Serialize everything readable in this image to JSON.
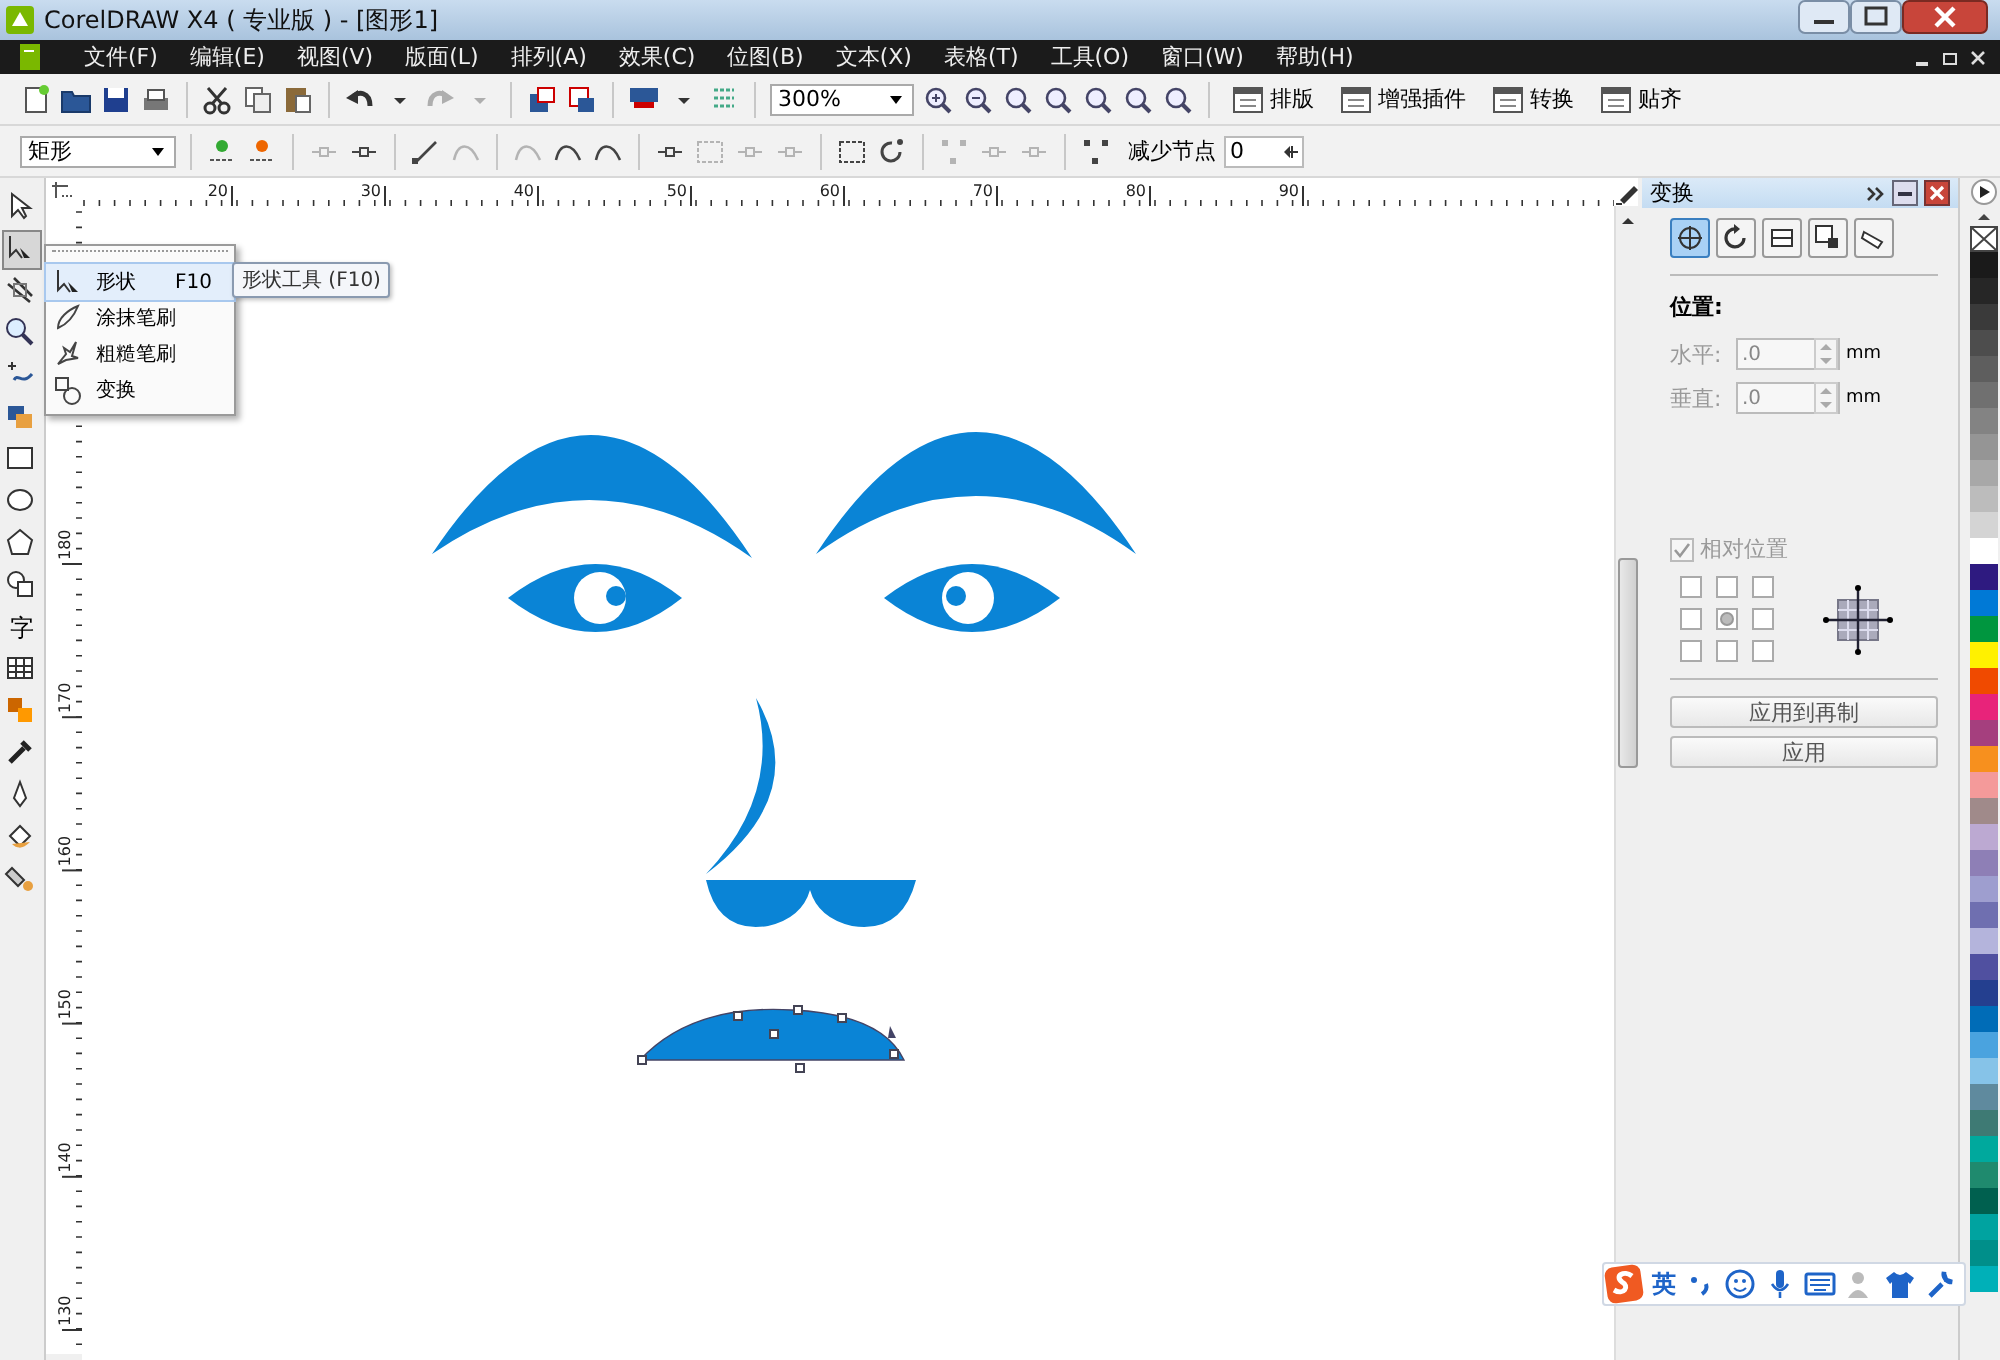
{
  "window": {
    "title": "CorelDRAW X4 ( 专业版 ) - [图形1]"
  },
  "menu_bar": {
    "items": [
      "文件(F)",
      "编辑(E)",
      "视图(V)",
      "版面(L)",
      "排列(A)",
      "效果(C)",
      "位图(B)",
      "文本(X)",
      "表格(T)",
      "工具(O)",
      "窗口(W)",
      "帮助(H)"
    ]
  },
  "standard_toolbar": {
    "buttons": [
      {
        "disabled": false
      },
      {
        "disabled": false
      },
      {
        "disabled": false
      },
      {
        "disabled": false
      },
      {
        "disabled": false
      },
      {
        "disabled": false
      },
      {
        "disabled": false
      },
      {
        "disabled": false
      },
      {
        "disabled": false
      },
      {
        "disabled": true
      },
      {
        "disabled": true
      },
      {
        "disabled": false
      },
      {
        "disabled": false
      },
      {
        "disabled": false
      },
      {
        "disabled": false
      },
      {
        "disabled": false
      }
    ],
    "zoom_level": "300%",
    "zoom_buttons": [
      {
        "disabled": false
      },
      {
        "disabled": false
      },
      {
        "disabled": false
      },
      {
        "disabled": false
      },
      {
        "disabled": false
      },
      {
        "disabled": false
      },
      {
        "disabled": false
      }
    ],
    "plugin_buttons": [
      "排版",
      "增强插件",
      "转换",
      "贴齐"
    ]
  },
  "property_bar": {
    "object_type": "矩形",
    "buttons": [
      {
        "disabled": false
      },
      {
        "disabled": false
      },
      {
        "disabled": true
      },
      {
        "disabled": false
      },
      {
        "disabled": false
      },
      {
        "disabled": true
      },
      {
        "disabled": true
      },
      {
        "disabled": false
      },
      {
        "disabled": false
      },
      {
        "disabled": false
      },
      {
        "disabled": true
      },
      {
        "disabled": true
      },
      {
        "disabled": true
      },
      {
        "disabled": false
      },
      {
        "disabled": false
      },
      {
        "disabled": true
      },
      {
        "disabled": true
      },
      {
        "disabled": true
      },
      {
        "disabled": false
      }
    ],
    "reduce_nodes": {
      "label": "减少节点",
      "value": "0"
    }
  },
  "toolbox": {
    "tools": [
      {
        "selected": false
      },
      {
        "selected": true
      },
      {
        "selected": false
      },
      {
        "selected": false
      },
      {
        "selected": false
      },
      {
        "selected": false
      },
      {
        "selected": false
      },
      {
        "selected": false
      },
      {
        "selected": false
      },
      {
        "selected": false
      },
      {
        "selected": false,
        "glyph": "字"
      },
      {
        "selected": false
      },
      {
        "selected": false
      },
      {
        "selected": false
      },
      {
        "selected": false
      },
      {
        "selected": false
      },
      {
        "selected": false
      }
    ]
  },
  "flyout_menu": {
    "items": [
      {
        "label": "形状",
        "shortcut": "F10",
        "selected": true
      },
      {
        "label": "涂抹笔刷",
        "selected": false
      },
      {
        "label": "粗糙笔刷",
        "selected": false
      },
      {
        "label": "变换",
        "selected": false
      }
    ]
  },
  "tooltip": "形状工具 (F10)",
  "rulers": {
    "horizontal": [
      "20",
      "30",
      "40",
      "50",
      "60",
      "70",
      "80",
      "90"
    ],
    "vertical": [
      "180",
      "170",
      "160",
      "150",
      "140",
      "130"
    ]
  },
  "docker": {
    "title": "变换",
    "tabs": [
      {
        "selected": true
      },
      {
        "selected": false
      },
      {
        "selected": false
      },
      {
        "selected": false
      },
      {
        "selected": false
      }
    ],
    "section_label": "位置:",
    "fields": [
      {
        "label": "水平:",
        "value": ".0",
        "unit": "mm",
        "disabled": true
      },
      {
        "label": "垂直:",
        "value": ".0",
        "unit": "mm",
        "disabled": true
      }
    ],
    "relative_position": {
      "label": "相对位置",
      "checked": true,
      "disabled": true
    },
    "anchors": [
      {
        "selected": false
      },
      {
        "selected": false
      },
      {
        "selected": false
      },
      {
        "selected": false
      },
      {
        "selected": true
      },
      {
        "selected": false
      },
      {
        "selected": false
      },
      {
        "selected": false
      },
      {
        "selected": false
      }
    ],
    "buttons": [
      "应用到再制",
      "应用"
    ]
  },
  "palette": {
    "colors": [
      {
        "color": "#1a1a1a"
      },
      {
        "color": "#262626"
      },
      {
        "color": "#3a3a3a"
      },
      {
        "color": "#4d4d4d"
      },
      {
        "color": "#5e5e5e"
      },
      {
        "color": "#707070"
      },
      {
        "color": "#838383"
      },
      {
        "color": "#959595"
      },
      {
        "color": "#a8a8a8"
      },
      {
        "color": "#bcbcbc"
      },
      {
        "color": "#d4d4d4"
      },
      {
        "color": "#ffffff"
      },
      {
        "color": "#2e1a80"
      },
      {
        "color": "#0079d6"
      },
      {
        "color": "#00963f"
      },
      {
        "color": "#fff100"
      },
      {
        "color": "#f04a00"
      },
      {
        "color": "#e8237a"
      },
      {
        "color": "#a53f7e"
      },
      {
        "color": "#f7901e"
      },
      {
        "color": "#f49a9a"
      },
      {
        "color": "#a08a8a"
      },
      {
        "color": "#bca9d2"
      },
      {
        "color": "#8e7fb6"
      },
      {
        "color": "#9e9ecf"
      },
      {
        "color": "#6f6fb0"
      },
      {
        "color": "#b4b4dc"
      },
      {
        "color": "#5050a0"
      },
      {
        "color": "#243f8f"
      },
      {
        "color": "#006cb7"
      },
      {
        "color": "#4aa3df"
      },
      {
        "color": "#86c3e8"
      },
      {
        "color": "#5f8a9e"
      },
      {
        "color": "#3e7a74"
      },
      {
        "color": "#00a99d"
      },
      {
        "color": "#1f8a6e"
      },
      {
        "color": "#00604f"
      },
      {
        "color": "#00a3a0"
      },
      {
        "color": "#008f8a"
      },
      {
        "color": "#00b0b8"
      }
    ]
  },
  "ime_toolbar": {
    "mode": "英"
  }
}
